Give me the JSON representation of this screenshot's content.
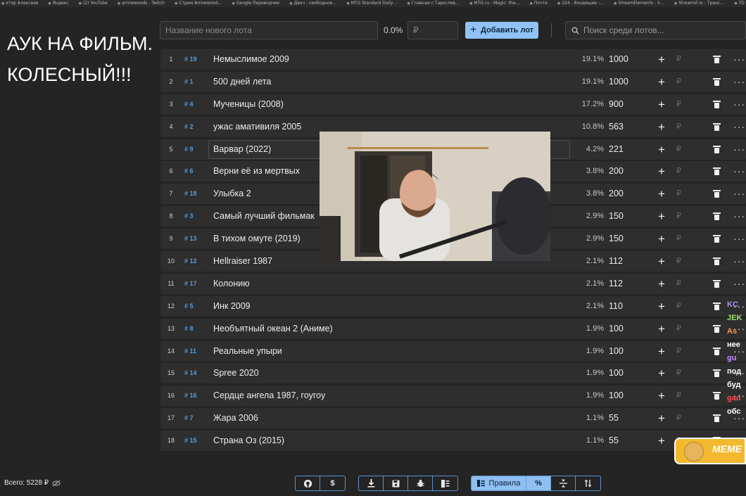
{
  "bookmarks": [
    "ктор Алексеев",
    "Яндекс",
    "(2) YouTube",
    "arrowwoods - Twitch",
    "Стрим Arrowwood…",
    "Google Переводчик",
    "Двач - свободное…",
    "MTG Standard Daily…",
    "Главная с Тарослев…",
    "MTG.ru - Magic: the…",
    "Почта",
    "224 - Входящие -…",
    "StreamElements - S…",
    "StreamVi.io - Транс…",
    "TD Главная - TOPDeck…"
  ],
  "overlay_title": "АУК НА ФИЛЬМ. КОЛЕСНЫЙ!!!",
  "topbar": {
    "lot_name_placeholder": "Название нового лота",
    "percent": "0.0%",
    "rub_placeholder": "₽",
    "add_label": "Добавить лот",
    "search_placeholder": "Поиск среди лотов..."
  },
  "rows": [
    {
      "idx": "1",
      "hid": "# 19",
      "name": "Немыслимое 2009",
      "share": "19.1%",
      "amount": "1000"
    },
    {
      "idx": "2",
      "hid": "# 1",
      "name": "500 дней лета",
      "share": "19.1%",
      "amount": "1000"
    },
    {
      "idx": "3",
      "hid": "# 4",
      "name": "Мученицы (2008)",
      "share": "17.2%",
      "amount": "900"
    },
    {
      "idx": "4",
      "hid": "# 2",
      "name": "ужас амативиля 2005",
      "share": "10.8%",
      "amount": "563"
    },
    {
      "idx": "5",
      "hid": "# 9",
      "name": "Варвар (2022)",
      "share": "4.2%",
      "amount": "221"
    },
    {
      "idx": "6",
      "hid": "# 6",
      "name": "Верни её из мертвых",
      "share": "3.8%",
      "amount": "200"
    },
    {
      "idx": "7",
      "hid": "# 18",
      "name": "Улыбка 2",
      "share": "3.8%",
      "amount": "200"
    },
    {
      "idx": "8",
      "hid": "# 3",
      "name": "Самый лучший фильмак",
      "share": "2.9%",
      "amount": "150"
    },
    {
      "idx": "9",
      "hid": "# 13",
      "name": "В тихом омуте (2019)",
      "share": "2.9%",
      "amount": "150"
    },
    {
      "idx": "10",
      "hid": "# 12",
      "name": "Hellraiser 1987",
      "share": "2.1%",
      "amount": "112"
    },
    {
      "idx": "11",
      "hid": "# 17",
      "name": "Колонию",
      "share": "2.1%",
      "amount": "112"
    },
    {
      "idx": "12",
      "hid": "# 5",
      "name": "Инк 2009",
      "share": "2.1%",
      "amount": "110"
    },
    {
      "idx": "13",
      "hid": "# 8",
      "name": "Необъятный океан 2 (Аниме)",
      "share": "1.9%",
      "amount": "100"
    },
    {
      "idx": "14",
      "hid": "# 11",
      "name": "Реальные упыри",
      "share": "1.9%",
      "amount": "100"
    },
    {
      "idx": "15",
      "hid": "# 14",
      "name": "Spree 2020",
      "share": "1.9%",
      "amount": "100"
    },
    {
      "idx": "16",
      "hid": "# 16",
      "name": "Сердце ангела 1987, гоугоу",
      "share": "1.9%",
      "amount": "100"
    },
    {
      "idx": "17",
      "hid": "# 7",
      "name": "Жара 2006",
      "share": "1.1%",
      "amount": "55"
    },
    {
      "idx": "18",
      "hid": "# 15",
      "name": "Страна Оз (2015)",
      "share": "1.1%",
      "amount": "55"
    }
  ],
  "row_controls": {
    "add": "+",
    "rub": "₽",
    "more": "···"
  },
  "chat": [
    {
      "text": "KC",
      "color": "#b58cff"
    },
    {
      "text": "JEK",
      "color": "#9be36d"
    },
    {
      "text": "As",
      "color": "#ff9a4d"
    },
    {
      "text": "нее",
      "color": "#ffffff"
    },
    {
      "text": "gu",
      "color": "#c58cff"
    },
    {
      "text": "под",
      "color": "#ffffff"
    },
    {
      "text": "буд",
      "color": "#ffffff"
    },
    {
      "text": "gad",
      "color": "#ff4d4d"
    },
    {
      "text": "обс",
      "color": "#ffffff"
    }
  ],
  "meme_label": "MEME",
  "bottom": {
    "total": "Всего: 5228 ₽",
    "rules_label": "Правила",
    "percent_label": "%"
  },
  "colors": {
    "accent": "#90c2f5",
    "row_bg": "#2e2e2e",
    "page_bg": "#242424",
    "id_blue": "#5b9bd5"
  }
}
